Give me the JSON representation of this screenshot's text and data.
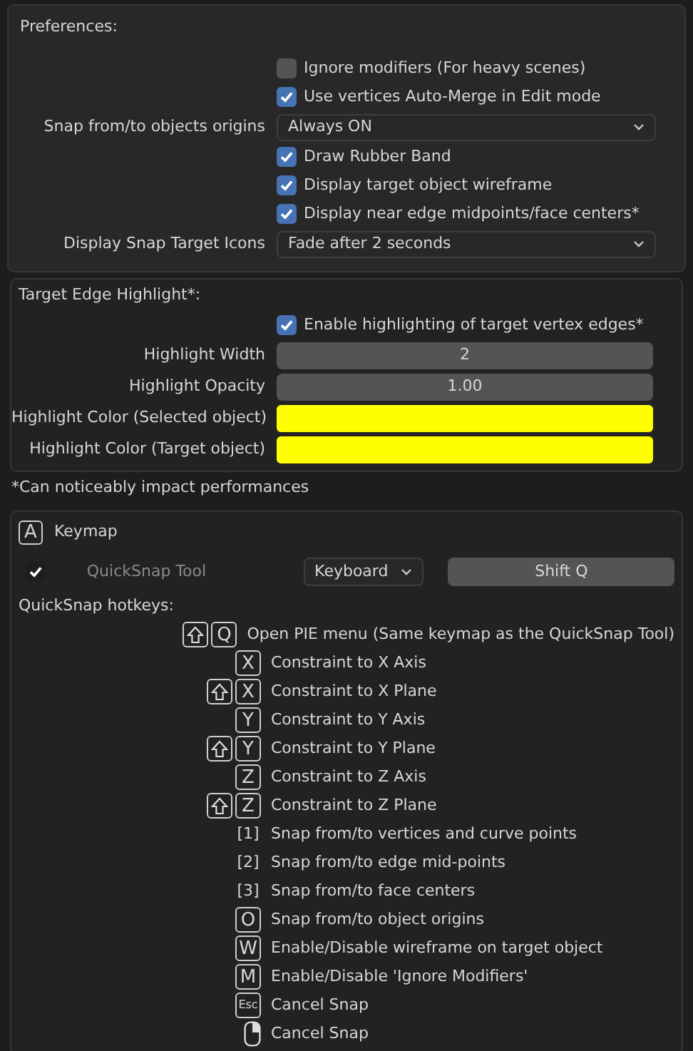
{
  "preferences": {
    "title": "Preferences:",
    "rows": [
      {
        "kind": "checkbox",
        "label": "Ignore modifiers (For heavy scenes)",
        "checked": false
      },
      {
        "kind": "checkbox",
        "label": "Use vertices Auto-Merge in Edit mode",
        "checked": true
      },
      {
        "kind": "dropdown",
        "label": "Snap from/to objects origins",
        "value": "Always ON"
      },
      {
        "kind": "checkbox",
        "label": "Draw Rubber Band",
        "checked": true
      },
      {
        "kind": "checkbox",
        "label": "Display target object wireframe",
        "checked": true
      },
      {
        "kind": "checkbox",
        "label": "Display near edge midpoints/face centers*",
        "checked": true
      },
      {
        "kind": "dropdown",
        "label": "Display Snap Target Icons",
        "value": "Fade after 2 seconds"
      }
    ],
    "highlight": {
      "title": "Target Edge Highlight*:",
      "rows": [
        {
          "kind": "checkbox",
          "label": "Enable highlighting of target vertex edges*",
          "checked": true
        },
        {
          "kind": "number",
          "label": "Highlight Width",
          "value": "2"
        },
        {
          "kind": "number",
          "label": "Highlight Opacity",
          "value": "1.00"
        },
        {
          "kind": "color",
          "label": "Highlight Color (Selected object)",
          "color": "#ffff00"
        },
        {
          "kind": "color",
          "label": "Highlight Color (Target object)",
          "color": "#ffff00"
        }
      ]
    },
    "note": "*Can noticeably impact performances"
  },
  "keymap": {
    "icon_key": "A",
    "title": "Keymap",
    "tool": {
      "enabled": true,
      "label": "QuickSnap Tool",
      "device": "Keyboard",
      "shortcut": "Shift Q"
    },
    "hotkeys_title": "QuickSnap hotkeys:",
    "hotkeys": [
      {
        "keys": [
          {
            "kind": "shift"
          },
          {
            "kind": "key",
            "text": "Q"
          }
        ],
        "action": "Open PIE menu (Same keymap as the QuickSnap Tool)"
      },
      {
        "keys": [
          {
            "kind": "key",
            "text": "X"
          }
        ],
        "action": "Constraint to X Axis"
      },
      {
        "keys": [
          {
            "kind": "shift"
          },
          {
            "kind": "key",
            "text": "X"
          }
        ],
        "action": "Constraint to X Plane"
      },
      {
        "keys": [
          {
            "kind": "key",
            "text": "Y"
          }
        ],
        "action": "Constraint to Y Axis"
      },
      {
        "keys": [
          {
            "kind": "shift"
          },
          {
            "kind": "key",
            "text": "Y"
          }
        ],
        "action": "Constraint to Y Plane"
      },
      {
        "keys": [
          {
            "kind": "key",
            "text": "Z"
          }
        ],
        "action": "Constraint to Z Axis"
      },
      {
        "keys": [
          {
            "kind": "shift"
          },
          {
            "kind": "key",
            "text": "Z"
          }
        ],
        "action": "Constraint to Z Plane"
      },
      {
        "keys": [
          {
            "kind": "plain",
            "text": "[1]"
          }
        ],
        "action": "Snap from/to vertices and curve points"
      },
      {
        "keys": [
          {
            "kind": "plain",
            "text": "[2]"
          }
        ],
        "action": "Snap from/to edge mid-points"
      },
      {
        "keys": [
          {
            "kind": "plain",
            "text": "[3]"
          }
        ],
        "action": "Snap from/to face centers"
      },
      {
        "keys": [
          {
            "kind": "key",
            "text": "O"
          }
        ],
        "action": "Snap from/to object origins"
      },
      {
        "keys": [
          {
            "kind": "key",
            "text": "W"
          }
        ],
        "action": "Enable/Disable wireframe on target object"
      },
      {
        "keys": [
          {
            "kind": "key",
            "text": "M"
          }
        ],
        "action": "Enable/Disable 'Ignore Modifiers'"
      },
      {
        "keys": [
          {
            "kind": "small_key",
            "text": "Esc"
          }
        ],
        "action": "Cancel Snap"
      },
      {
        "keys": [
          {
            "kind": "mouse"
          }
        ],
        "action": "Cancel Snap"
      }
    ]
  }
}
